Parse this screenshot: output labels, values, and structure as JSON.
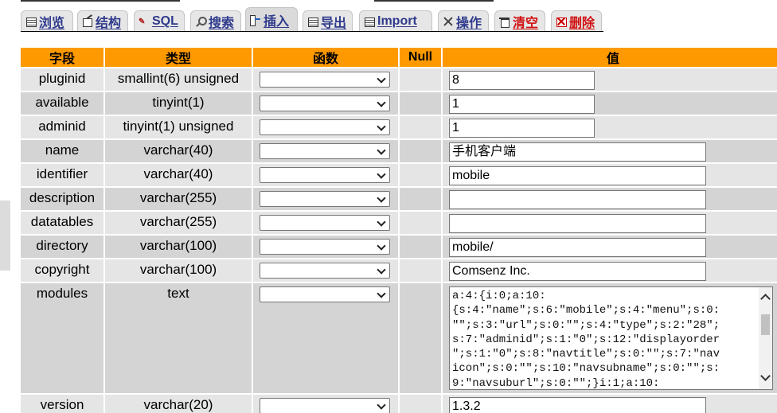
{
  "tabs": [
    {
      "key": "browse",
      "label": "浏览",
      "icon": "browse-icon",
      "active": false,
      "danger": false
    },
    {
      "key": "structure",
      "label": "结构",
      "icon": "structure-icon",
      "active": false,
      "danger": false
    },
    {
      "key": "sql",
      "label": "SQL",
      "icon": "sql-icon",
      "active": false,
      "danger": false
    },
    {
      "key": "search",
      "label": "搜索",
      "icon": "search-icon",
      "active": false,
      "danger": false
    },
    {
      "key": "insert",
      "label": "插入",
      "icon": "insert-icon",
      "active": true,
      "danger": false
    },
    {
      "key": "export",
      "label": "导出",
      "icon": "export-icon",
      "active": false,
      "danger": false
    },
    {
      "key": "import",
      "label": "Import",
      "icon": "import-icon",
      "active": false,
      "danger": false
    },
    {
      "key": "operations",
      "label": "操作",
      "icon": "operations-icon",
      "active": false,
      "danger": false
    },
    {
      "key": "empty",
      "label": "清空",
      "icon": "empty-icon",
      "active": false,
      "danger": true
    },
    {
      "key": "drop",
      "label": "删除",
      "icon": "drop-icon",
      "active": false,
      "danger": true
    }
  ],
  "table": {
    "headers": {
      "field": "字段",
      "type": "类型",
      "function": "函数",
      "null": "Null",
      "value": "值"
    },
    "rows": [
      {
        "field": "pluginid",
        "type": "smallint(6) unsigned",
        "function": "",
        "value": "8",
        "input": "short"
      },
      {
        "field": "available",
        "type": "tinyint(1)",
        "function": "",
        "value": "1",
        "input": "short"
      },
      {
        "field": "adminid",
        "type": "tinyint(1) unsigned",
        "function": "",
        "value": "1",
        "input": "short"
      },
      {
        "field": "name",
        "type": "varchar(40)",
        "function": "",
        "value": "手机客户端",
        "input": "long"
      },
      {
        "field": "identifier",
        "type": "varchar(40)",
        "function": "",
        "value": "mobile",
        "input": "long"
      },
      {
        "field": "description",
        "type": "varchar(255)",
        "function": "",
        "value": "",
        "input": "long"
      },
      {
        "field": "datatables",
        "type": "varchar(255)",
        "function": "",
        "value": "",
        "input": "long"
      },
      {
        "field": "directory",
        "type": "varchar(100)",
        "function": "",
        "value": "mobile/",
        "input": "long"
      },
      {
        "field": "copyright",
        "type": "varchar(100)",
        "function": "",
        "value": "Comsenz Inc.",
        "input": "long"
      },
      {
        "field": "modules",
        "type": "text",
        "function": "",
        "value": "a:4:{i:0;a:10:\n{s:4:\"name\";s:6:\"mobile\";s:4:\"menu\";s:0:\n\"\";s:3:\"url\";s:0:\"\";s:4:\"type\";s:2:\"28\";\ns:7:\"adminid\";s:1:\"0\";s:12:\"displayorder\n\";s:1:\"0\";s:8:\"navtitle\";s:0:\"\";s:7:\"nav\nicon\";s:0:\"\";s:10:\"navsubname\";s:0:\"\";s:\n9:\"navsuburl\";s:0:\"\";}i:1;a:10:",
        "input": "textarea"
      },
      {
        "field": "version",
        "type": "varchar(20)",
        "function": "",
        "value": "1.3.2",
        "input": "long"
      }
    ]
  },
  "colors": {
    "header_bg": "#ff9900",
    "row_bg": "#e5e5e5",
    "row_alt_bg": "#d4d4d4",
    "tab_text": "#2f3a8c",
    "tab_danger": "#d01010"
  }
}
